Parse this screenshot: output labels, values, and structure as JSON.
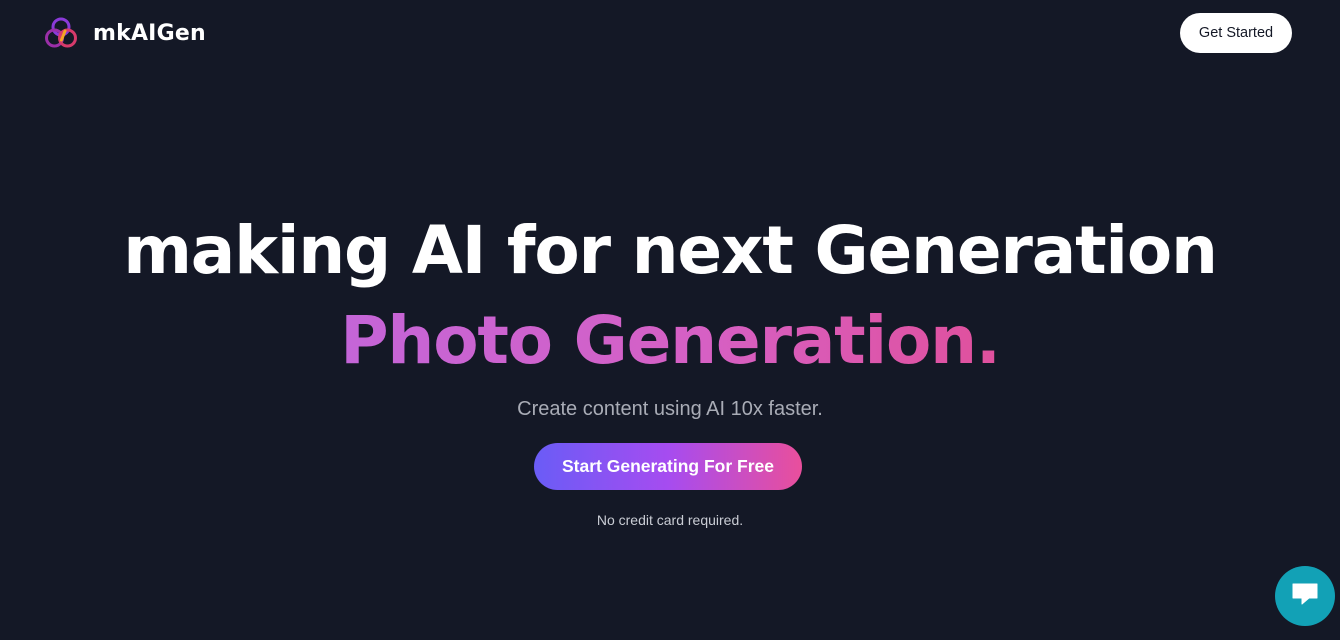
{
  "brand": {
    "name": "mkAIGen",
    "icon": "three-rings-logo-icon",
    "colors": [
      "#7c3aed",
      "#db2777",
      "#f59e0b"
    ]
  },
  "header": {
    "cta_label": "Get Started"
  },
  "hero": {
    "headline": "making AI for next Generation",
    "highlight": "Photo Generation.",
    "subtitle": "Create content using AI 10x faster.",
    "cta_label": "Start Generating For Free",
    "note": "No credit card required."
  },
  "chat_widget": {
    "icon": "chat-bubble-icon",
    "color": "#12a1b6"
  },
  "theme": {
    "background": "#141826",
    "gradient_start": "#6a5cf6",
    "gradient_end": "#e94f9c"
  }
}
